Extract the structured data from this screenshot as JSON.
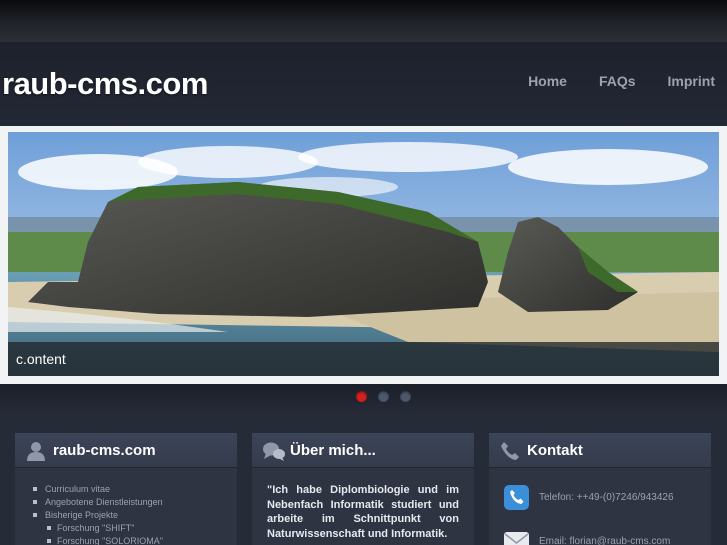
{
  "site": {
    "title": "raub-cms.com"
  },
  "nav": {
    "items": [
      "Home",
      "FAQs",
      "Imprint"
    ]
  },
  "slider": {
    "caption": "c.ontent",
    "dots": 3,
    "active_dot": 0
  },
  "boxes": {
    "about_site": {
      "title": "raub-cms.com",
      "menu": [
        {
          "label": "Curriculum vitae",
          "level": 0
        },
        {
          "label": "Angebotene Dienstleistungen",
          "level": 0
        },
        {
          "label": "Bisherige Projekte",
          "level": 0
        },
        {
          "label": "Forschung \"SHIFT\"",
          "level": 1
        },
        {
          "label": "Forschung \"SOLORIOMA\"",
          "level": 1
        }
      ]
    },
    "about_me": {
      "title": "Über mich...",
      "text": "\"Ich habe Diplombiologie und im Nebenfach Informatik studiert und arbeite im Schnittpunkt von Naturwissenschaft und Informatik."
    },
    "contact": {
      "title": "Kontakt",
      "phone": "Telefon: ++49-(0)7246/943426",
      "email": "Email: florian@raub-cms.com"
    }
  },
  "colors": {
    "accent_dot": "#d42020",
    "background": "#262b38"
  }
}
